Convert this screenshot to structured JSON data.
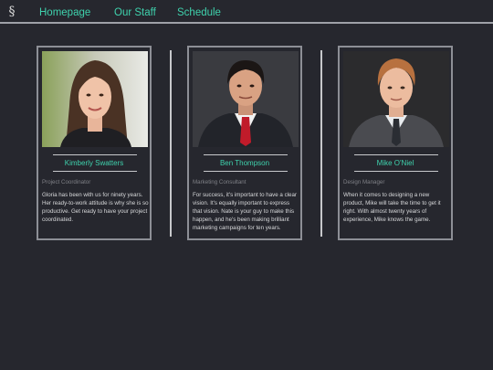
{
  "nav": {
    "logo_glyph": "§",
    "links": [
      "Homepage",
      "Our Staff",
      "Schedule"
    ],
    "accent_color": "#3fd2ad"
  },
  "staff": [
    {
      "name": "Kimberly Swatters",
      "role": "Project Coordinator",
      "bio": "Gloria has been with us for ninety years. Her ready-to-work attitude is why she is so productive. Get ready to have your project coordinated."
    },
    {
      "name": "Ben Thompson",
      "role": "Marketing Consultant",
      "bio": "For success, it's important to have a clear vision. It's equally important to express that vision. Nate is your guy to make this happen, and he's been making brilliant marketing campaigns for ten years."
    },
    {
      "name": "Mike O'Niel",
      "role": "Design Manager",
      "bio": "When it comes to designing a new product, Mike will take the time to get it right. With almost twenty years of experience, Mike knows the game."
    }
  ]
}
